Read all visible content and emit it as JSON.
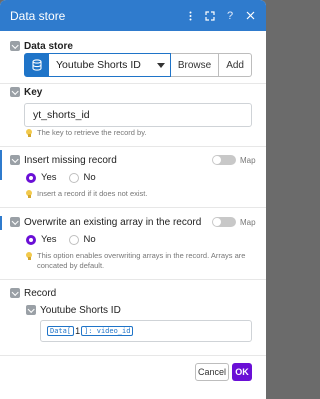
{
  "header": {
    "title": "Data store",
    "icons": [
      "kebab-icon",
      "expand-icon",
      "help-icon",
      "close-icon"
    ]
  },
  "data_store": {
    "label": "Data store",
    "selected": "Youtube Shorts ID",
    "browse_label": "Browse",
    "add_label": "Add"
  },
  "key": {
    "label": "Key",
    "value": "yt_shorts_id",
    "hint": "The key to retrieve the record by."
  },
  "insert_missing": {
    "label": "Insert missing record",
    "map_label": "Map",
    "yes_label": "Yes",
    "no_label": "No",
    "selected": "Yes",
    "hint": "Insert a record if it does not exist."
  },
  "overwrite": {
    "label": "Overwrite an existing array in the record",
    "map_label": "Map",
    "yes_label": "Yes",
    "no_label": "No",
    "selected": "Yes",
    "hint_line1": "This option enables overwriting arrays in the record. Arrays are",
    "hint_line2": "concated by default."
  },
  "record": {
    "label": "Record",
    "sub_label": "Youtube Shorts ID",
    "token_prefix": "Data[",
    "token_index": "1",
    "token_suffix": "]: video_id"
  },
  "footer": {
    "cancel_label": "Cancel",
    "ok_label": "OK"
  },
  "colors": {
    "header": "#2f7bcd",
    "accent": "#1f74c8",
    "ok": "#6a0fd6"
  }
}
